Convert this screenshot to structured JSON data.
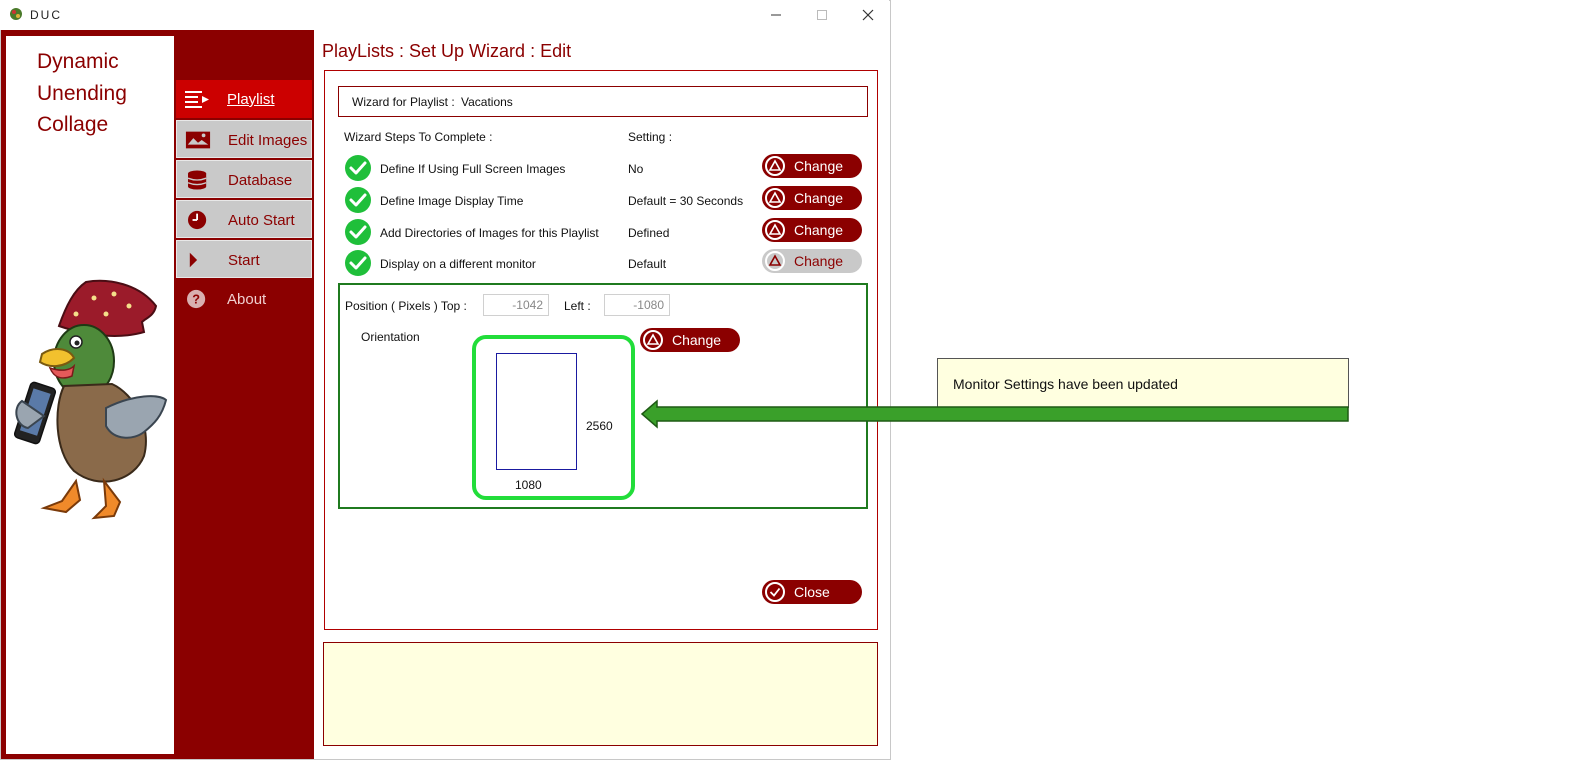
{
  "window": {
    "title": "DUC"
  },
  "sidebar": {
    "brand_lines": [
      "Dynamic",
      "Unending",
      "Collage"
    ],
    "items": [
      {
        "label": "Playlist",
        "icon": "playlist-icon"
      },
      {
        "label": "Edit Images",
        "icon": "image-icon"
      },
      {
        "label": "Database",
        "icon": "database-icon"
      },
      {
        "label": "Auto Start",
        "icon": "clock-icon"
      },
      {
        "label": "Start",
        "icon": "play-icon"
      },
      {
        "label": "About",
        "icon": "question-icon"
      }
    ]
  },
  "main": {
    "title": "PlayLists : Set Up Wizard : Edit",
    "playlist_label": "Wizard for Playlist :",
    "playlist_name": "Vacations",
    "steps_header": "Wizard Steps To Complete :",
    "setting_header": "Setting :",
    "steps": [
      {
        "text": "Define If Using Full Screen Images",
        "setting": "No",
        "button": "Change"
      },
      {
        "text": "Define Image Display Time",
        "setting": "Default = 30 Seconds",
        "button": "Change"
      },
      {
        "text": "Add Directories of Images for this Playlist",
        "setting": "Defined",
        "button": "Change"
      },
      {
        "text": "Display on a different monitor",
        "setting": "Default",
        "button": "Change"
      }
    ],
    "monitor": {
      "position_label": "Position ( Pixels )  Top :",
      "top_value": "-1042",
      "left_label": "Left :",
      "left_value": "-1080",
      "orientation_label": "Orientation",
      "orientation_button": "Change",
      "height_value": "2560",
      "width_value": "1080"
    },
    "close_button": "Close"
  },
  "callout": {
    "text": "Monitor Settings have been updated"
  },
  "colors": {
    "accent": "#8b0000",
    "active": "#cc0000",
    "success": "#1fbf3a",
    "note_bg": "#ffffe0",
    "arrow": "#3aa02a"
  }
}
